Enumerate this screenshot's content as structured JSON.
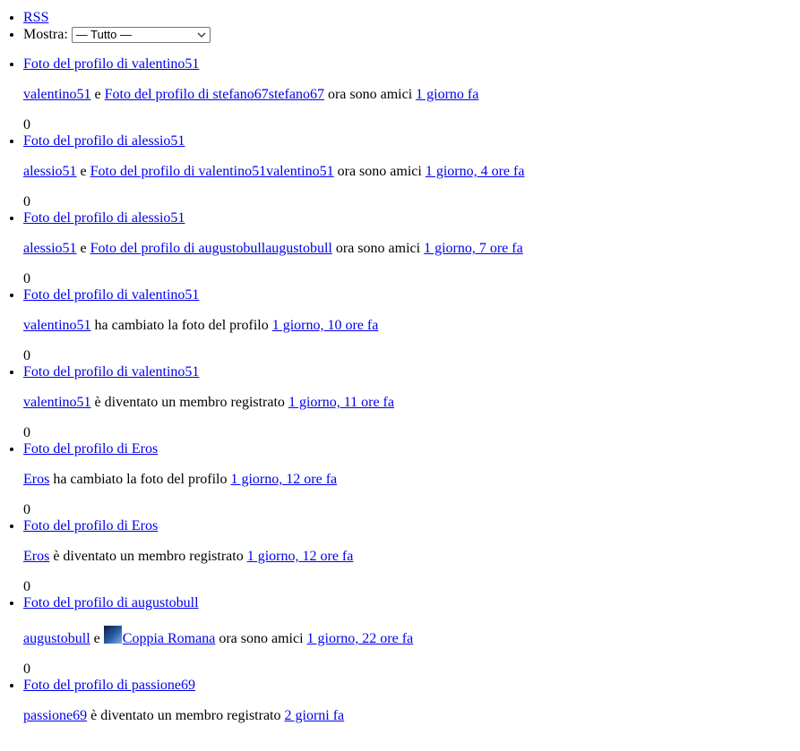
{
  "top": {
    "rss_label": "RSS",
    "filter_label": "Mostra:",
    "filter_value": "— Tutto —"
  },
  "activities": [
    {
      "avatar_link": "Foto del profilo di valentino51",
      "user": "valentino51",
      "connector": "e",
      "target": "Foto del profilo di stefano67stefano67",
      "action": "ora sono amici",
      "time": "1 giorno fa",
      "count": "0"
    },
    {
      "avatar_link": "Foto del profilo di alessio51",
      "user": "alessio51",
      "connector": "e",
      "target": "Foto del profilo di valentino51valentino51",
      "action": "ora sono amici",
      "time": "1 giorno, 4 ore fa",
      "count": "0"
    },
    {
      "avatar_link": "Foto del profilo di alessio51",
      "user": "alessio51",
      "connector": "e",
      "target": "Foto del profilo di augustobullaugustobull",
      "action": "ora sono amici",
      "time": "1 giorno, 7 ore fa",
      "count": "0"
    },
    {
      "avatar_link": "Foto del profilo di valentino51",
      "user": "valentino51",
      "action": "ha cambiato la foto del profilo",
      "time": "1 giorno, 10 ore fa",
      "count": "0"
    },
    {
      "avatar_link": "Foto del profilo di valentino51",
      "user": "valentino51",
      "action": "è diventato un membro registrato",
      "time": "1 giorno, 11 ore fa",
      "count": "0"
    },
    {
      "avatar_link": "Foto del profilo di Eros",
      "user": "Eros",
      "action": "ha cambiato la foto del profilo",
      "time": "1 giorno, 12 ore fa",
      "count": "0"
    },
    {
      "avatar_link": "Foto del profilo di Eros",
      "user": "Eros",
      "action": "è diventato un membro registrato",
      "time": "1 giorno, 12 ore fa",
      "count": "0"
    },
    {
      "avatar_link": "Foto del profilo di augustobull",
      "user": "augustobull",
      "connector": "e",
      "target": "Coppia Romana",
      "target_has_avatar": true,
      "action": "ora sono amici",
      "time": "1 giorno, 22 ore fa",
      "count": "0"
    },
    {
      "avatar_link": "Foto del profilo di passione69",
      "user": "passione69",
      "action": "è diventato un membro registrato",
      "time": "2 giorni fa"
    }
  ]
}
